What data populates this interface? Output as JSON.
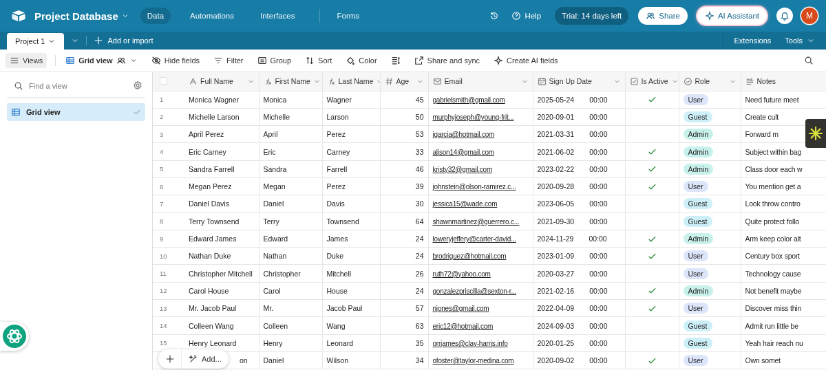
{
  "app": {
    "title": "Project Database",
    "avatar": "M",
    "nav": [
      {
        "label": "Data",
        "selected": true
      },
      {
        "label": "Automations",
        "selected": false
      },
      {
        "label": "Interfaces",
        "selected": false
      },
      {
        "label": "Forms",
        "selected": false
      }
    ],
    "help": "Help",
    "trial": "Trial: 14 days left",
    "share": "Share",
    "ai_assistant": "AI Assistant"
  },
  "tables_bar": {
    "tabs": [
      {
        "label": "Project 1",
        "selected": true
      }
    ],
    "add": "Add or import",
    "extensions": "Extensions",
    "tools": "Tools"
  },
  "toolbar": {
    "views": "Views",
    "view_name": "Grid view",
    "items": [
      {
        "kind": "hide",
        "label": "Hide fields"
      },
      {
        "kind": "filter",
        "label": "Filter"
      },
      {
        "kind": "group",
        "label": "Group"
      },
      {
        "kind": "sort",
        "label": "Sort"
      },
      {
        "kind": "color",
        "label": "Color"
      },
      {
        "kind": "height"
      },
      {
        "kind": "share",
        "label": "Share and sync"
      },
      {
        "kind": "ai",
        "label": "Create AI fields"
      }
    ]
  },
  "sidebar": {
    "search": {
      "placeholder": "Find a view"
    },
    "items": [
      {
        "label": "Grid view",
        "selected": true
      }
    ]
  },
  "table": {
    "header_checkbox": {
      "checked": false
    },
    "columns": [
      {
        "kind": "text",
        "label": "Full Name"
      },
      {
        "kind": "formula",
        "label": "First Name"
      },
      {
        "kind": "formula",
        "label": "Last Name"
      },
      {
        "kind": "number",
        "label": "Age"
      },
      {
        "kind": "email",
        "label": "Email"
      },
      {
        "kind": "date",
        "label": "Sign Up Date"
      },
      {
        "kind": "checkbox",
        "label": "Is Active"
      },
      {
        "kind": "select",
        "label": "Role"
      },
      {
        "kind": "longtext",
        "label": "Notes"
      }
    ],
    "rows": [
      {
        "n": "1",
        "full": "Monica Wagner",
        "first": "Monica",
        "last": "Wagner",
        "age": "45",
        "email": "gabrielsmith@gmail.com",
        "date": "2025-05-24",
        "time": "00:00",
        "active": true,
        "role": {
          "label": "User",
          "color": "#dde5fb"
        },
        "notes": "Need future meet"
      },
      {
        "n": "2",
        "full": "Michelle Larson",
        "first": "Michelle",
        "last": "Larson",
        "age": "50",
        "email": "murphyjoseph@young-frit...",
        "date": "2020-09-01",
        "time": "00:00",
        "active": false,
        "role": {
          "label": "Guest",
          "color": "#cdeff7"
        },
        "notes": "Create cult"
      },
      {
        "n": "3",
        "full": "April Perez",
        "first": "April",
        "last": "Perez",
        "age": "53",
        "email": "igarcia@hotmail.com",
        "date": "2021-03-31",
        "time": "00:00",
        "active": false,
        "role": {
          "label": "Admin",
          "color": "#c9f1ec"
        },
        "notes": "Forward m"
      },
      {
        "n": "4",
        "full": "Eric Carney",
        "first": "Eric",
        "last": "Carney",
        "age": "33",
        "email": "alison14@gmail.com",
        "date": "2021-06-02",
        "time": "00:00",
        "active": true,
        "role": {
          "label": "Admin",
          "color": "#c9f1ec"
        },
        "notes": "Subject within bag"
      },
      {
        "n": "5",
        "full": "Sandra Farrell",
        "first": "Sandra",
        "last": "Farrell",
        "age": "46",
        "email": "kristy32@gmail.com",
        "date": "2023-02-22",
        "time": "00:00",
        "active": true,
        "role": {
          "label": "Admin",
          "color": "#c9f1ec"
        },
        "notes": "Class door each w"
      },
      {
        "n": "6",
        "full": "Megan Perez",
        "first": "Megan",
        "last": "Perez",
        "age": "39",
        "email": "johnstein@olson-ramirez.c...",
        "date": "2020-09-28",
        "time": "00:00",
        "active": true,
        "role": {
          "label": "User",
          "color": "#dde5fb"
        },
        "notes": "You mention get a"
      },
      {
        "n": "7",
        "full": "Daniel Davis",
        "first": "Daniel",
        "last": "Davis",
        "age": "30",
        "email": "jessica15@wade.com",
        "date": "2023-06-05",
        "time": "00:00",
        "active": false,
        "role": {
          "label": "Guest",
          "color": "#cdeff7"
        },
        "notes": "Look throw contro"
      },
      {
        "n": "8",
        "full": "Terry Townsend",
        "first": "Terry",
        "last": "Townsend",
        "age": "64",
        "email": "shawnmartinez@guerrero.c...",
        "date": "2021-09-30",
        "time": "00:00",
        "active": false,
        "role": {
          "label": "Guest",
          "color": "#cdeff7"
        },
        "notes": "Quite protect follo"
      },
      {
        "n": "9",
        "full": "Edward James",
        "first": "Edward",
        "last": "James",
        "age": "24",
        "email": "loweryjeffery@carter-david...",
        "date": "2024-11-29",
        "time": "00:00",
        "active": true,
        "role": {
          "label": "Admin",
          "color": "#c9f1ec"
        },
        "notes": "Arm keep color alt"
      },
      {
        "n": "10",
        "full": "Nathan Duke",
        "first": "Nathan",
        "last": "Duke",
        "age": "24",
        "email": "brodriguez@hotmail.com",
        "date": "2023-01-09",
        "time": "00:00",
        "active": true,
        "role": {
          "label": "User",
          "color": "#dde5fb"
        },
        "notes": "Century box sport"
      },
      {
        "n": "11",
        "full": "Christopher Mitchell",
        "first": "Christopher",
        "last": "Mitchell",
        "age": "26",
        "email": "ruth72@yahoo.com",
        "date": "2020-03-27",
        "time": "00:00",
        "active": false,
        "role": {
          "label": "User",
          "color": "#dde5fb"
        },
        "notes": "Technology cause"
      },
      {
        "n": "12",
        "full": "Carol House",
        "first": "Carol",
        "last": "House",
        "age": "24",
        "email": "gonzalezpriscilla@sexton-r...",
        "date": "2021-02-16",
        "time": "00:00",
        "active": true,
        "role": {
          "label": "Admin",
          "color": "#c9f1ec"
        },
        "notes": "Not benefit maybe"
      },
      {
        "n": "13",
        "full": "Mr. Jacob Paul",
        "first": "Mr.",
        "last": "Jacob Paul",
        "age": "57",
        "email": "njones@gmail.com",
        "date": "2022-04-09",
        "time": "00:00",
        "active": true,
        "role": {
          "label": "User",
          "color": "#dde5fb"
        },
        "notes": "Discover miss thin"
      },
      {
        "n": "14",
        "full": "Colleen Wang",
        "first": "Colleen",
        "last": "Wang",
        "age": "63",
        "email": "eric12@hotmail.com",
        "date": "2024-09-03",
        "time": "00:00",
        "active": false,
        "role": {
          "label": "Guest",
          "color": "#cdeff7"
        },
        "notes": "Admit run little be"
      },
      {
        "n": "15",
        "full": "Henry Leonard",
        "first": "Henry",
        "last": "Leonard",
        "age": "35",
        "email": "orrjames@clay-harris.info",
        "date": "2020-01-25",
        "time": "00:00",
        "active": false,
        "role": {
          "label": "Guest",
          "color": "#cdeff7"
        },
        "notes": "Yeah hair reach nu"
      },
      {
        "full": "on",
        "first": "Daniel",
        "last": "Wilson",
        "age": "34",
        "email": "ofoster@taylor-medina.com",
        "date": "2020-09-02",
        "time": "00:00",
        "active": true,
        "role": {
          "label": "User",
          "color": "#dde5fb"
        },
        "notes": "Own somet"
      }
    ]
  },
  "floating_bar": {
    "add_label": "Add..."
  }
}
